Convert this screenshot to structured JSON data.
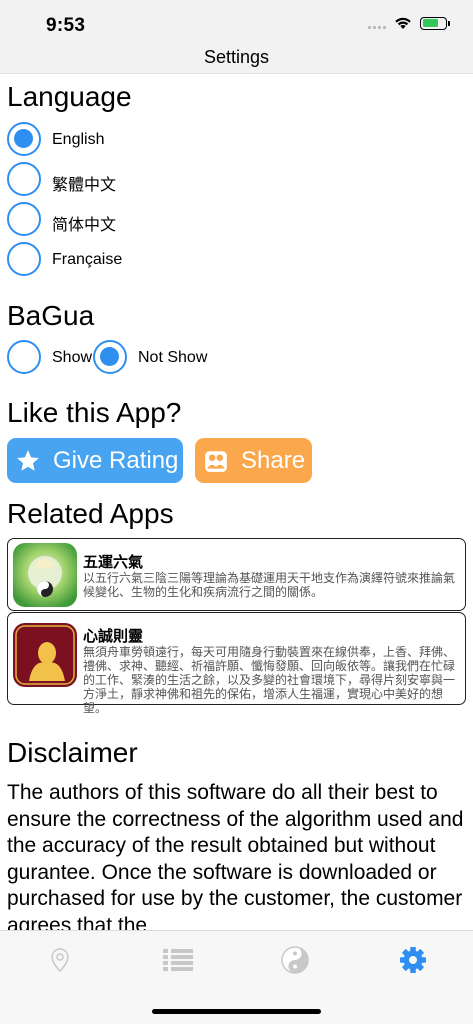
{
  "status": {
    "time": "9:53"
  },
  "nav": {
    "title": "Settings"
  },
  "language": {
    "title": "Language",
    "options": [
      "English",
      "繁體中文",
      "简体中文",
      "Française"
    ],
    "selected": "English"
  },
  "bagua": {
    "title": "BaGua",
    "options": [
      "Show",
      "Not Show"
    ],
    "selected": "Not Show"
  },
  "like": {
    "title": "Like this App?",
    "rating_label": "Give Rating",
    "share_label": "Share",
    "rating_color": "#48a4f0",
    "share_color": "#fba74b"
  },
  "related": {
    "title": "Related Apps",
    "apps": [
      {
        "name": "五運六氣",
        "description": "以五行六氣三陰三陽等理論為基礎運用天干地支作為演繹符號來推論氣候變化、生物的生化和疾病流行之間的關係。"
      },
      {
        "name": "心誠則靈",
        "description": "無須舟車勞頓遠行，每天可用隨身行動裝置來在線供奉，上香、拜佛、禮佛、求神、聽經、祈福許願、懺悔發願、回向皈依等。讓我們在忙碌的工作、緊湊的生活之餘，以及多變的社會環境下，尋得片刻安寧與一方淨土，靜求神佛和祖先的保佑，增添人生福運，實現心中美好的想望。"
      }
    ]
  },
  "disclaimer": {
    "title": "Disclaimer",
    "text": "The authors of this software do all their best to ensure the correctness of the algorithm used and the accuracy of the result obtained but without gurantee. Once the software is downloaded or purchased for use by the customer, the customer agrees that the"
  },
  "tabs": {
    "items": [
      "location-icon",
      "list-icon",
      "yin-yang-icon",
      "gear-icon"
    ],
    "active": "gear-icon",
    "active_color": "#2f8ff0",
    "inactive_color": "#c8c8c8"
  }
}
